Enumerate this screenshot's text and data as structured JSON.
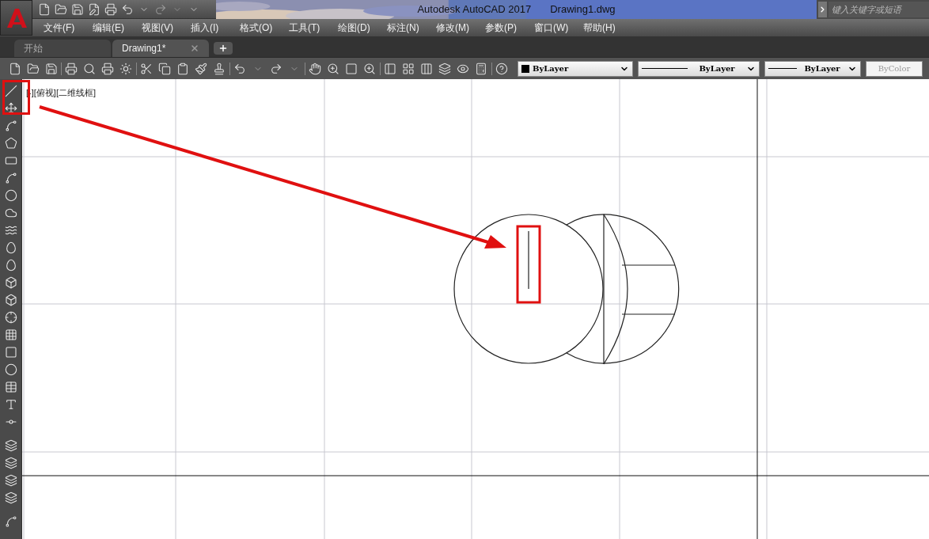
{
  "title_bar": {
    "app_name": "Autodesk AutoCAD 2017",
    "file_name": "Drawing1.dwg",
    "search": {
      "placeholder": "键入关键字或短语"
    }
  },
  "menu_bar": [
    "文件(F)",
    "编辑(E)",
    "视图(V)",
    "插入(I)",
    "格式(O)",
    "工具(T)",
    "绘图(D)",
    "标注(N)",
    "修改(M)",
    "参数(P)",
    "窗口(W)",
    "帮助(H)"
  ],
  "tabs": [
    {
      "label": "开始",
      "selected": false,
      "closable": false
    },
    {
      "label": "Drawing1*",
      "selected": true,
      "closable": true
    }
  ],
  "properties": [
    {
      "kind": "color",
      "value": "ByLayer",
      "disabled": false
    },
    {
      "kind": "linetype",
      "value": "ByLayer",
      "disabled": false
    },
    {
      "kind": "lineweight",
      "value": "ByLayer",
      "disabled": false
    },
    {
      "kind": "plotstyle",
      "value": "ByColor",
      "disabled": true
    }
  ],
  "viewport": {
    "label": "[-][俯视][二维线框]"
  }
}
